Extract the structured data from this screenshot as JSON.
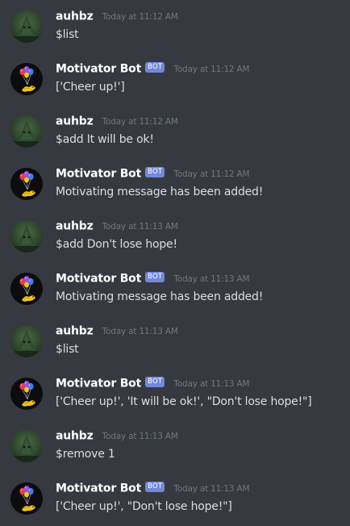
{
  "messages": [
    {
      "author": "auhbz",
      "is_bot": false,
      "timestamp": "Today at 11:12 AM",
      "content": "$list",
      "avatar_icon": "green-user-avatar-icon"
    },
    {
      "author": "Motivator Bot",
      "is_bot": true,
      "bot_tag": "BOT",
      "timestamp": "Today at 11:12 AM",
      "content": "['Cheer up!']",
      "avatar_icon": "balloons-avatar-icon"
    },
    {
      "author": "auhbz",
      "is_bot": false,
      "timestamp": "Today at 11:12 AM",
      "content": "$add It will be ok!",
      "avatar_icon": "green-user-avatar-icon"
    },
    {
      "author": "Motivator Bot",
      "is_bot": true,
      "bot_tag": "BOT",
      "timestamp": "Today at 11:12 AM",
      "content": "Motivating message has been added!",
      "avatar_icon": "balloons-avatar-icon"
    },
    {
      "author": "auhbz",
      "is_bot": false,
      "timestamp": "Today at 11:13 AM",
      "content": "$add Don't lose hope!",
      "avatar_icon": "green-user-avatar-icon"
    },
    {
      "author": "Motivator Bot",
      "is_bot": true,
      "bot_tag": "BOT",
      "timestamp": "Today at 11:13 AM",
      "content": "Motivating message has been added!",
      "avatar_icon": "balloons-avatar-icon"
    },
    {
      "author": "auhbz",
      "is_bot": false,
      "timestamp": "Today at 11:13 AM",
      "content": "$list",
      "avatar_icon": "green-user-avatar-icon"
    },
    {
      "author": "Motivator Bot",
      "is_bot": true,
      "bot_tag": "BOT",
      "timestamp": "Today at 11:13 AM",
      "content": "['Cheer up!', 'It will be ok!', \"Don't lose hope!\"]",
      "avatar_icon": "balloons-avatar-icon"
    },
    {
      "author": "auhbz",
      "is_bot": false,
      "timestamp": "Today at 11:13 AM",
      "content": "$remove 1",
      "avatar_icon": "green-user-avatar-icon"
    },
    {
      "author": "Motivator Bot",
      "is_bot": true,
      "bot_tag": "BOT",
      "timestamp": "Today at 11:13 AM",
      "content": "['Cheer up!', \"Don't lose hope!\"]",
      "avatar_icon": "balloons-avatar-icon"
    }
  ],
  "colors": {
    "background": "#36393f",
    "username": "#ffffff",
    "message_text": "#dcddde",
    "timestamp": "#72767d",
    "bot_tag": "#7289da"
  }
}
